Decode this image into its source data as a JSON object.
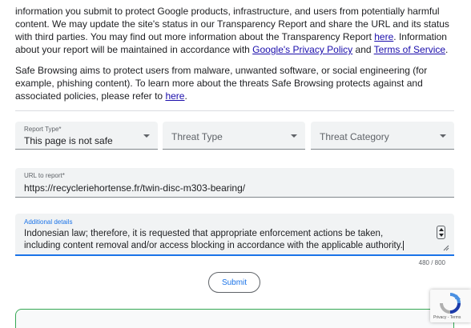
{
  "intro": {
    "p1_a": "information you submit to protect Google products, infrastructure, and users from potentially harmful content. We may update the site's status in our Transparency Report and share the URL and its status with third parties. You may find out more information about the Transparency Report ",
    "p1_link1": "here",
    "p1_b": ". Information about your report will be maintained in accordance with ",
    "p1_link2": "Google's Privacy Policy",
    "p1_c": " and ",
    "p1_link3": "Terms of Service",
    "p1_d": ".",
    "p2_a": "Safe Browsing aims to protect users from malware, unwanted software, or social engineering (for example, phishing content). To learn more about the threats Safe Browsing protects against and associated policies, please refer to ",
    "p2_link": "here",
    "p2_b": "."
  },
  "form": {
    "report_type": {
      "label": "Report Type*",
      "value": "This page is not safe"
    },
    "threat_type": {
      "placeholder": "Threat Type"
    },
    "threat_category": {
      "placeholder": "Threat Category"
    },
    "url": {
      "label": "URL to report*",
      "value": "https://recycleriehortense.fr/twin-disc-m303-bearing/"
    },
    "details": {
      "label": "Additional details",
      "value": "Indonesian law; therefore, it is requested that appropriate enforcement actions be taken, including content removal and/or access blocking in accordance with the applicable authority.",
      "counter": "480 / 800"
    },
    "submit_label": "Submit"
  },
  "recaptcha": {
    "links": "Privacy - Terms"
  },
  "colors": {
    "accent": "#1a73e8",
    "link": "#1a0dab",
    "field_bg": "#f1f3f4",
    "success": "#34a853"
  }
}
